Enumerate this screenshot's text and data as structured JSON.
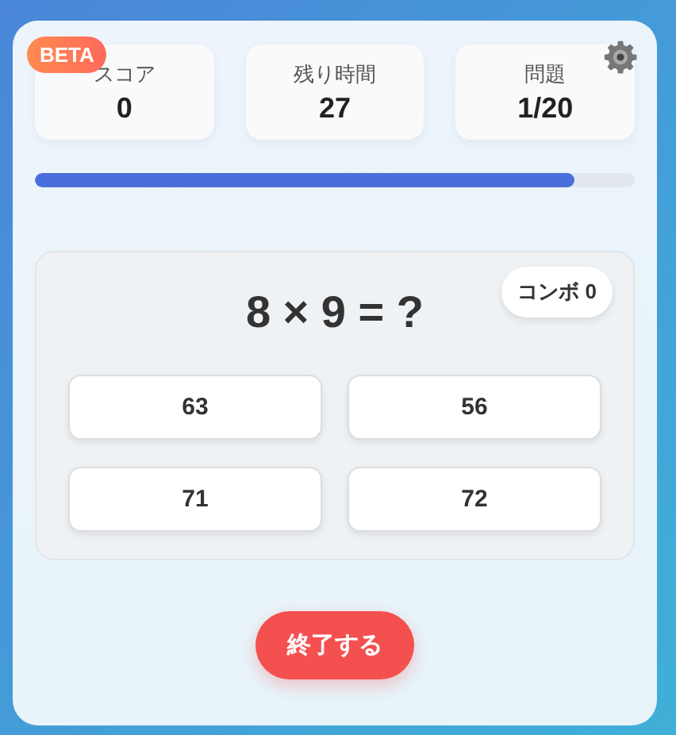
{
  "badge": {
    "label": "BETA"
  },
  "stats": [
    {
      "label": "スコア",
      "value": "0"
    },
    {
      "label": "残り時間",
      "value": "27"
    },
    {
      "label": "問題",
      "value": "1/20"
    }
  ],
  "timer": {
    "level": 0.9
  },
  "question": {
    "text": "8 × 9 = ?",
    "combo": "コンボ 0"
  },
  "answers": [
    {
      "label": "63"
    },
    {
      "label": "56"
    },
    {
      "label": "71"
    },
    {
      "label": "72"
    }
  ],
  "end_button": {
    "label": "終了する"
  }
}
